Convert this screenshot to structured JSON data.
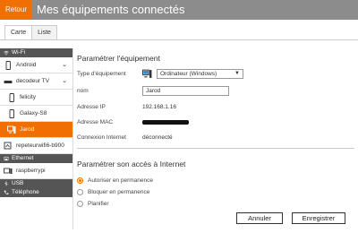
{
  "header": {
    "back_label": "Retour",
    "title": "Mes équipements connectés"
  },
  "tabs": [
    {
      "label": "Carte"
    },
    {
      "label": "Liste"
    }
  ],
  "sidebar": {
    "wifi_label": "Wi-Fi",
    "wifi_devices": [
      {
        "label": "Android",
        "icon": "smartphone-icon",
        "expandable": true
      },
      {
        "label": "decodeur TV",
        "icon": "tv-decoder-icon",
        "expandable": true
      },
      {
        "label": "felicity",
        "icon": "smartphone-icon"
      },
      {
        "label": "Galaxy-S8",
        "icon": "smartphone-icon"
      },
      {
        "label": "Jarod",
        "icon": "computer-icon",
        "selected": true
      },
      {
        "label": "repeteurwifi6-b900",
        "icon": "repeater-icon"
      }
    ],
    "ethernet_label": "Ethernet",
    "ethernet_devices": [
      {
        "label": "raspberrypi",
        "icon": "server-icon"
      }
    ],
    "usb_label": "USB",
    "phone_label": "Téléphone"
  },
  "settings": {
    "title": "Paramétrer l'équipement",
    "type_label": "Type d'équipement",
    "type_value": "Ordinateur (Windows)",
    "name_label": "nom",
    "name_value": "Jarod",
    "ip_label": "Adresse IP",
    "ip_value": "192.168.1.16",
    "mac_label": "Adresse MAC",
    "connection_label": "Connexion Internet",
    "connection_value": "déconnecté"
  },
  "access": {
    "title": "Paramétrer son accès à Internet",
    "options": [
      {
        "label": "Autoriser en permanence",
        "selected": true
      },
      {
        "label": "Bloquer en permanence",
        "selected": false
      },
      {
        "label": "Planifier",
        "selected": false
      }
    ]
  },
  "buttons": {
    "cancel": "Annuler",
    "save": "Enregistrer"
  },
  "colors": {
    "accent": "#f16e00",
    "header_bg": "#8c8c8c",
    "section_bg": "#555555"
  }
}
